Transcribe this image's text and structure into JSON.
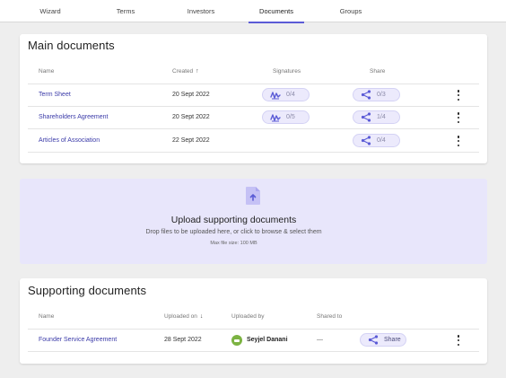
{
  "nav": {
    "tabs": [
      {
        "label": "Wizard"
      },
      {
        "label": "Terms"
      },
      {
        "label": "Investors"
      },
      {
        "label": "Documents"
      },
      {
        "label": "Groups"
      }
    ],
    "active_tab": "Documents",
    "accent_color": "#5b5bd6"
  },
  "main_docs": {
    "title": "Main documents",
    "headers": {
      "name": "Name",
      "created": "Created",
      "signatures": "Signatures",
      "share": "Share"
    },
    "sort_icon": "arrow-up-icon",
    "rows": [
      {
        "name": "Term Sheet",
        "created": "20 Sept 2022",
        "signatures": "0/4",
        "share": "0/3"
      },
      {
        "name": "Shareholders Agreement",
        "created": "20 Sept 2022",
        "signatures": "0/5",
        "share": "1/4"
      },
      {
        "name": "Articles of Association",
        "created": "22 Sept 2022",
        "signatures": null,
        "share": "0/4"
      }
    ]
  },
  "upload": {
    "title": "Upload supporting documents",
    "subtitle": "Drop files to be uploaded here, or click to browse & select them",
    "max_size": "Max file size: 100 MB",
    "icon": "file-upload-icon",
    "background": "#e8e6fb"
  },
  "supporting_docs": {
    "title": "Supporting documents",
    "headers": {
      "name": "Name",
      "uploaded_on": "Uploaded on",
      "uploaded_by": "Uploaded by",
      "shared_to": "Shared to"
    },
    "sort_icon": "arrow-down-icon",
    "rows": [
      {
        "name": "Founder Service Agreement",
        "uploaded_on": "28 Sept 2022",
        "uploaded_by": "Seyjel Danani",
        "shared_to": "—",
        "share_label": "Share",
        "avatar_color": "#7cb342"
      }
    ]
  }
}
